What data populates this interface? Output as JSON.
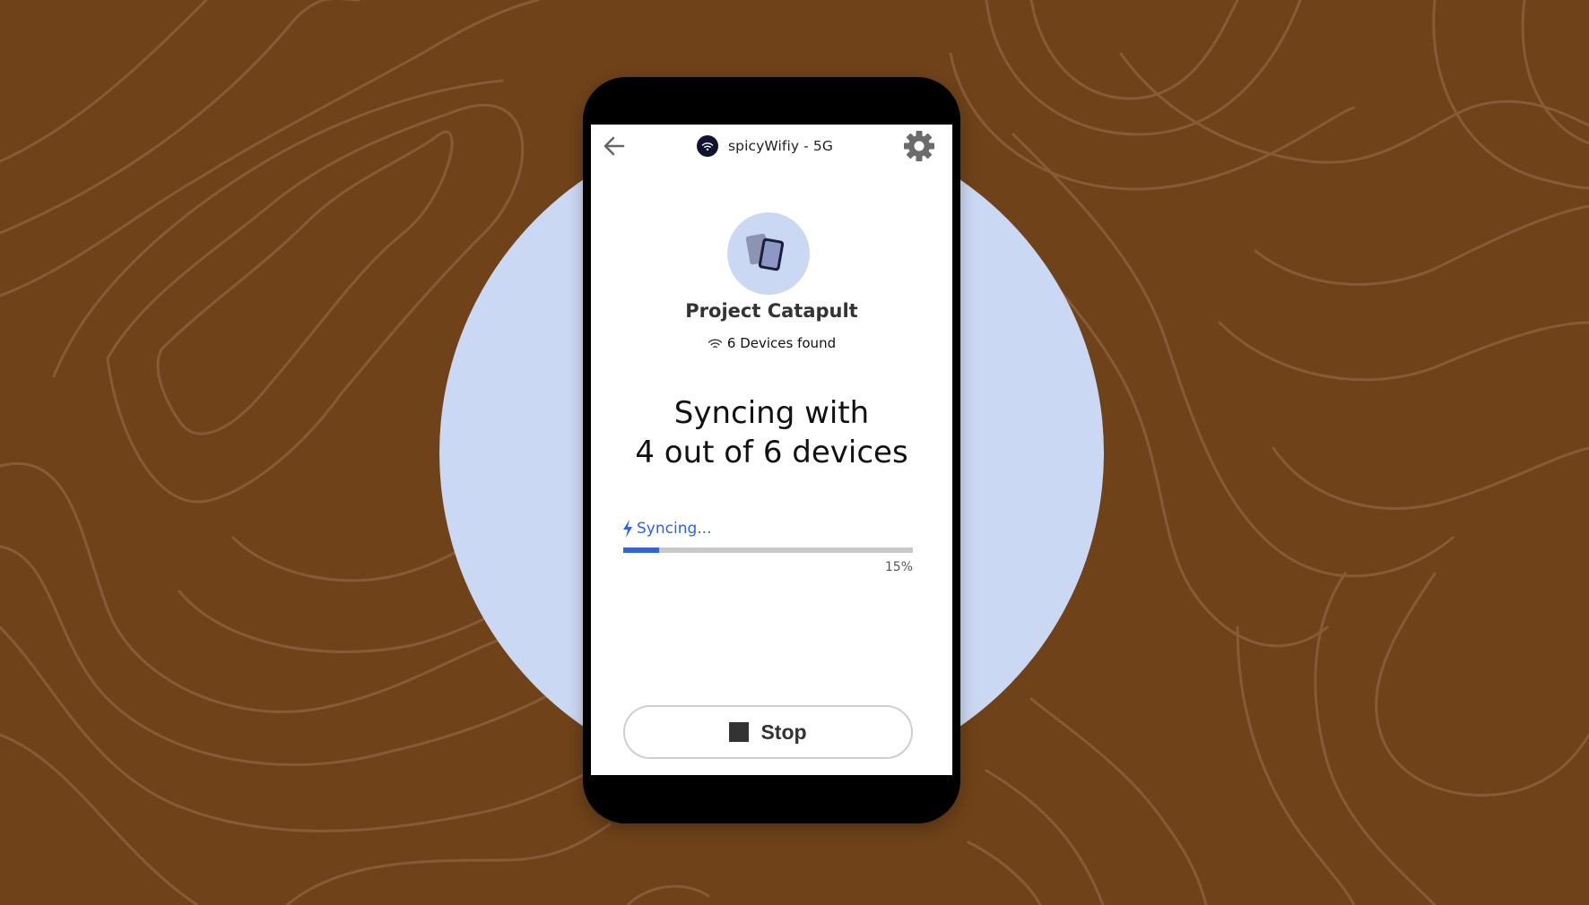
{
  "header": {
    "network_name": "spicyWifiy - 5G",
    "back_icon": "arrow-left-icon",
    "network_icon": "wifi-icon",
    "settings_icon": "gear-icon"
  },
  "project": {
    "name": "Project Catapult",
    "devices_found": "6 Devices found",
    "avatar_icon": "devices-icon"
  },
  "sync": {
    "title_line1": "Syncing with",
    "title_line2": "4 out of 6 devices",
    "status": "Syncing...",
    "progress_label": "15%",
    "progress_fraction": 0.125
  },
  "actions": {
    "stop_label": "Stop"
  },
  "colors": {
    "background": "#6f4219",
    "circle": "#cbd8f3",
    "accent": "#2f63e0",
    "network_badge": "#0f1330"
  }
}
